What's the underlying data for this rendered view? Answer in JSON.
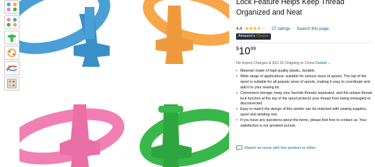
{
  "product": {
    "title": "Lock Feature Helps Keep Thread Organized and Neat",
    "rating_value": "4.4",
    "stars_display": "★★★★☆",
    "ratings_link": "27 ratings",
    "search_link": "Search this page",
    "badge_label": "Amazon's",
    "badge_accent": "Choice"
  },
  "price": {
    "symbol": "$",
    "whole": "10",
    "fraction": "99"
  },
  "shipping": {
    "text": "No Import Charges & $10.33 Shipping to China",
    "details_link": "Details",
    "chevron": "⌄"
  },
  "bullets": [
    "Material: made of high-quality plastic, durable.",
    "Wide range of applications: suitable for various sizes of spools. The top of the spool is suitable for all popular sizes of spools, making it easy to coordinate and add it to your sewing kit.",
    "Convenient storage: keep your favorite threads separated, and the unique thread lock function at the top of the spool protects your thread from being entangled or disconnected.",
    "Easy to match the design of this winder can be matched with sewing supplies, spool and winding reel.",
    "If you have any questions about the items, please feel free to contact us. Your satisfaction is our greatest pursuit."
  ],
  "report_link": "Report an issue with this product or seller",
  "colors": {
    "blue": "#4a9fd6",
    "orange": "#f7a64a",
    "pink": "#f27fb4",
    "green": "#38b84a",
    "star": "#ffa41c",
    "link": "#007185"
  },
  "thumbnails": [
    "thumb-multicolor",
    "thumb-multicolor",
    "thumb-green-spool",
    "thumb-orange-spool",
    "thumb-spools-pile",
    "thumb-spools-case"
  ]
}
